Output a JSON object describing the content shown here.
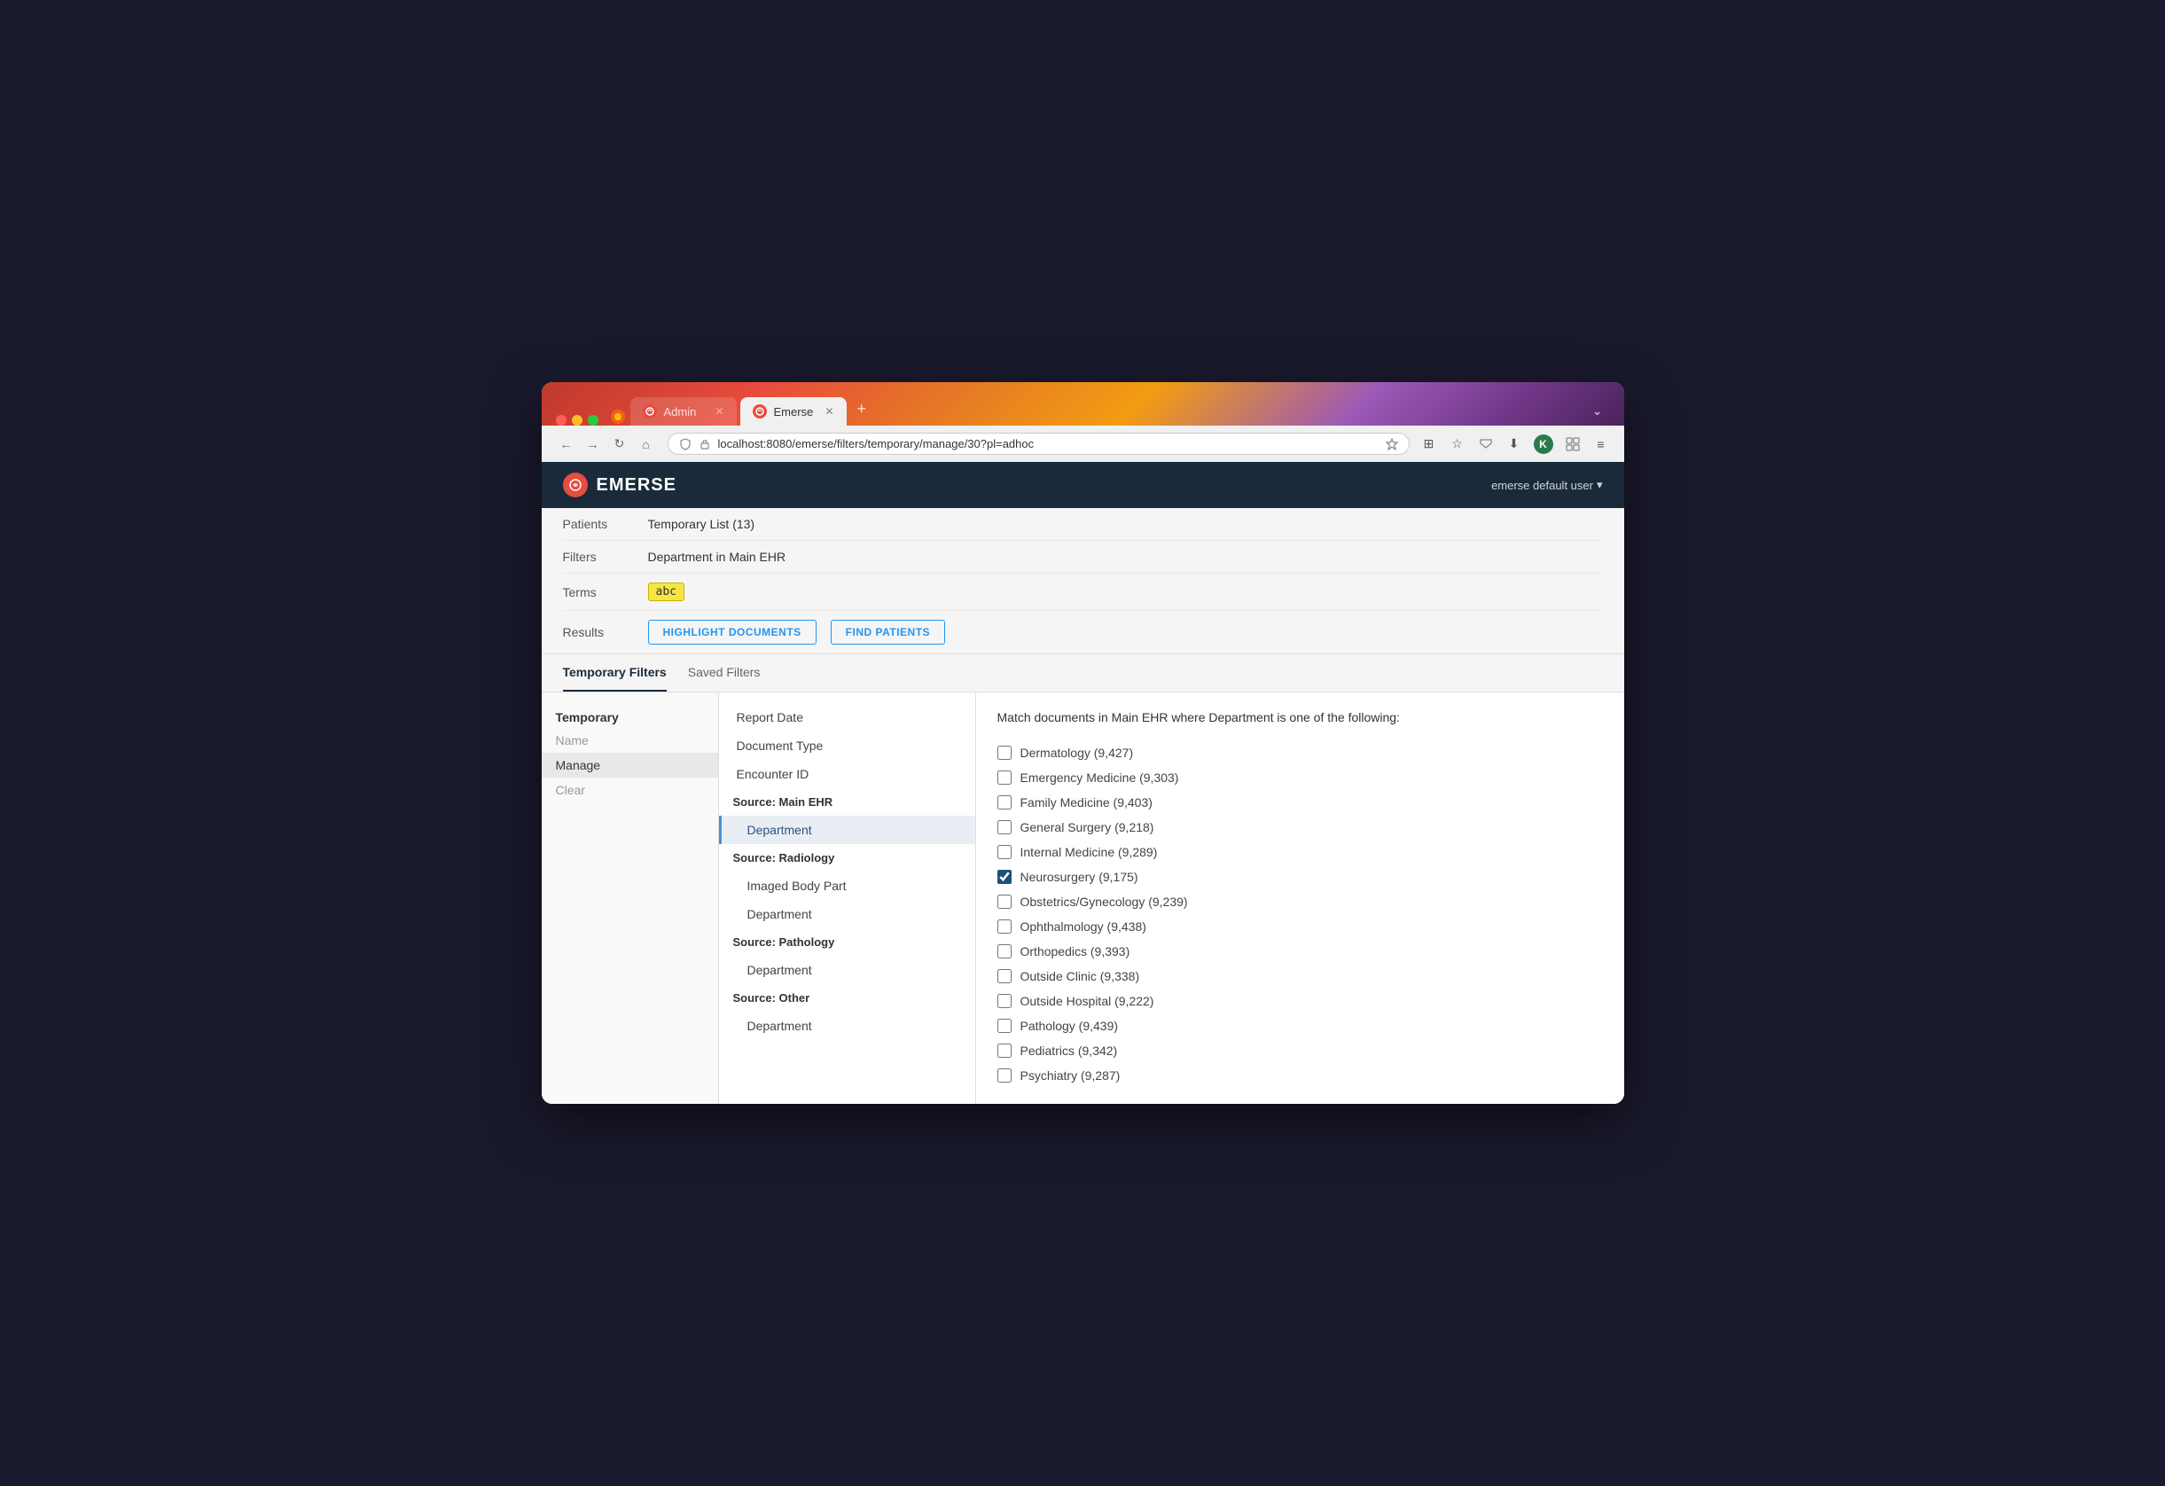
{
  "browser": {
    "tabs": [
      {
        "id": "admin",
        "label": "Admin",
        "active": false
      },
      {
        "id": "emerse",
        "label": "Emerse",
        "active": true
      }
    ],
    "address": "localhost:8080/emerse/filters/temporary/manage/30?pl=adhoc",
    "new_tab_icon": "+",
    "more_icon": "⌄"
  },
  "header": {
    "logo_text": "EMERSE",
    "user_label": "emerse default user",
    "user_dropdown": "▾"
  },
  "filter_bar": {
    "patients_label": "Patients",
    "patients_value": "Temporary List (13)",
    "filters_label": "Filters",
    "filters_value": "Department in Main EHR",
    "terms_label": "Terms",
    "terms_badge": "abc",
    "results_label": "Results",
    "highlight_btn": "HIGHLIGHT DOCUMENTS",
    "find_btn": "FIND PATIENTS"
  },
  "nav_tabs": [
    {
      "id": "temporary",
      "label": "Temporary Filters",
      "active": true
    },
    {
      "id": "saved",
      "label": "Saved Filters",
      "active": false
    }
  ],
  "sidebar": {
    "section_title": "Temporary",
    "items": [
      {
        "id": "name",
        "label": "Name",
        "active": false
      },
      {
        "id": "manage",
        "label": "Manage",
        "active": true
      },
      {
        "id": "clear",
        "label": "Clear",
        "active": false
      }
    ]
  },
  "filter_tree": {
    "items": [
      {
        "id": "report-date",
        "label": "Report Date",
        "type": "item",
        "indented": false,
        "section": false
      },
      {
        "id": "document-type",
        "label": "Document Type",
        "type": "item",
        "indented": false,
        "section": false
      },
      {
        "id": "encounter-id",
        "label": "Encounter ID",
        "type": "item",
        "indented": false,
        "section": false
      },
      {
        "id": "source-main",
        "label": "Source: Main EHR",
        "type": "section",
        "indented": false,
        "section": true
      },
      {
        "id": "dept-main",
        "label": "Department",
        "type": "item",
        "indented": true,
        "section": false,
        "selected": true
      },
      {
        "id": "source-radiology",
        "label": "Source: Radiology",
        "type": "section",
        "indented": false,
        "section": true
      },
      {
        "id": "imaged-body-part",
        "label": "Imaged Body Part",
        "type": "item",
        "indented": true,
        "section": false
      },
      {
        "id": "dept-radiology",
        "label": "Department",
        "type": "item",
        "indented": true,
        "section": false
      },
      {
        "id": "source-pathology",
        "label": "Source: Pathology",
        "type": "section",
        "indented": false,
        "section": true
      },
      {
        "id": "dept-pathology",
        "label": "Department",
        "type": "item",
        "indented": true,
        "section": false
      },
      {
        "id": "source-other",
        "label": "Source: Other",
        "type": "section",
        "indented": false,
        "section": true
      },
      {
        "id": "dept-other",
        "label": "Department",
        "type": "item",
        "indented": true,
        "section": false
      }
    ]
  },
  "content": {
    "title": "Match documents in Main EHR where Department is one of the following:",
    "departments": [
      {
        "id": "dermatology",
        "label": "Dermatology (9,427)",
        "checked": false
      },
      {
        "id": "emergency-medicine",
        "label": "Emergency Medicine (9,303)",
        "checked": false
      },
      {
        "id": "family-medicine",
        "label": "Family Medicine (9,403)",
        "checked": false
      },
      {
        "id": "general-surgery",
        "label": "General Surgery (9,218)",
        "checked": false
      },
      {
        "id": "internal-medicine",
        "label": "Internal Medicine (9,289)",
        "checked": false
      },
      {
        "id": "neurosurgery",
        "label": "Neurosurgery (9,175)",
        "checked": true
      },
      {
        "id": "ob-gyn",
        "label": "Obstetrics/Gynecology (9,239)",
        "checked": false
      },
      {
        "id": "ophthalmology",
        "label": "Ophthalmology (9,438)",
        "checked": false
      },
      {
        "id": "orthopedics",
        "label": "Orthopedics (9,393)",
        "checked": false
      },
      {
        "id": "outside-clinic",
        "label": "Outside Clinic (9,338)",
        "checked": false
      },
      {
        "id": "outside-hospital",
        "label": "Outside Hospital (9,222)",
        "checked": false
      },
      {
        "id": "pathology",
        "label": "Pathology (9,439)",
        "checked": false
      },
      {
        "id": "pediatrics",
        "label": "Pediatrics (9,342)",
        "checked": false
      },
      {
        "id": "psychiatry",
        "label": "Psychiatry (9,287)",
        "checked": false
      }
    ]
  }
}
